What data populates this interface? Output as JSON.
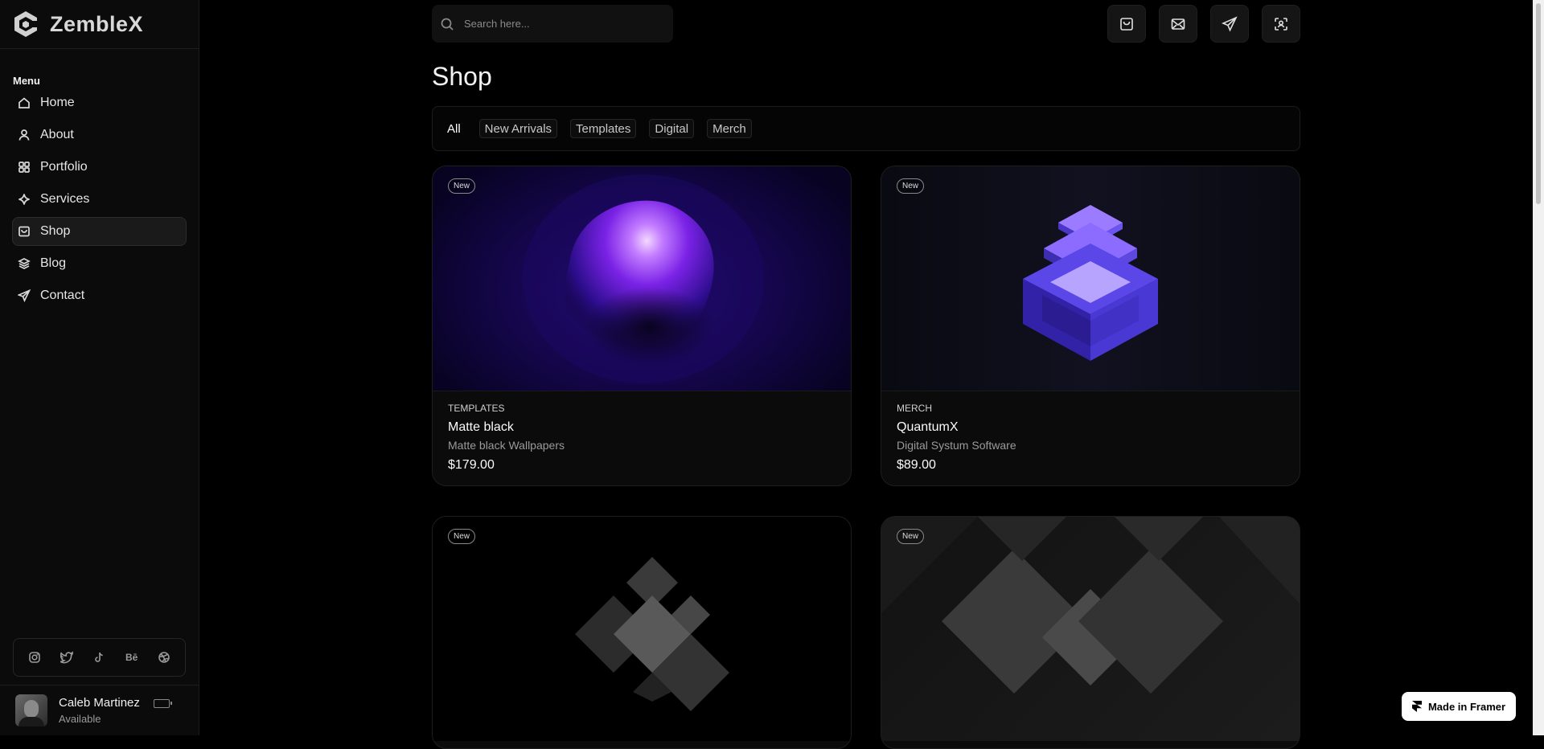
{
  "brand": {
    "name": "ZembleX"
  },
  "sidebar": {
    "menu_title": "Menu",
    "items": [
      {
        "label": "Home",
        "icon": "home-icon"
      },
      {
        "label": "About",
        "icon": "user-icon"
      },
      {
        "label": "Portfolio",
        "icon": "grid-icon"
      },
      {
        "label": "Services",
        "icon": "sparkle-icon"
      },
      {
        "label": "Shop",
        "icon": "bag-icon",
        "active": true
      },
      {
        "label": "Blog",
        "icon": "layers-icon"
      },
      {
        "label": "Contact",
        "icon": "send-icon"
      }
    ],
    "socials": [
      "instagram-icon",
      "twitter-icon",
      "tiktok-icon",
      "behance-icon",
      "dribbble-icon"
    ],
    "behance_label": "Bē",
    "user": {
      "name": "Caleb Martinez",
      "status": "Available"
    }
  },
  "topbar": {
    "search_placeholder": "Search here...",
    "buttons": [
      "bag-icon",
      "mail-icon",
      "send-icon",
      "scan-user-icon"
    ]
  },
  "page": {
    "title": "Shop"
  },
  "filters": [
    "All",
    "New Arrivals",
    "Templates",
    "Digital",
    "Merch"
  ],
  "active_filter": "All",
  "products": [
    {
      "badge": "New",
      "category": "TEMPLATES",
      "title": "Matte black",
      "description": "Matte black  Wallpapers",
      "price": "$179.00"
    },
    {
      "badge": "New",
      "category": "MERCH",
      "title": "QuantumX",
      "description": "Digital Systum Software",
      "price": "$89.00"
    },
    {
      "badge": "New"
    },
    {
      "badge": "New"
    }
  ],
  "framer_badge": "Made in Framer",
  "colors": {
    "background": "#000000",
    "sidebar": "#0b0b0b",
    "accent_purple": "#8a3cff",
    "accent_blue": "#5a4cff"
  }
}
